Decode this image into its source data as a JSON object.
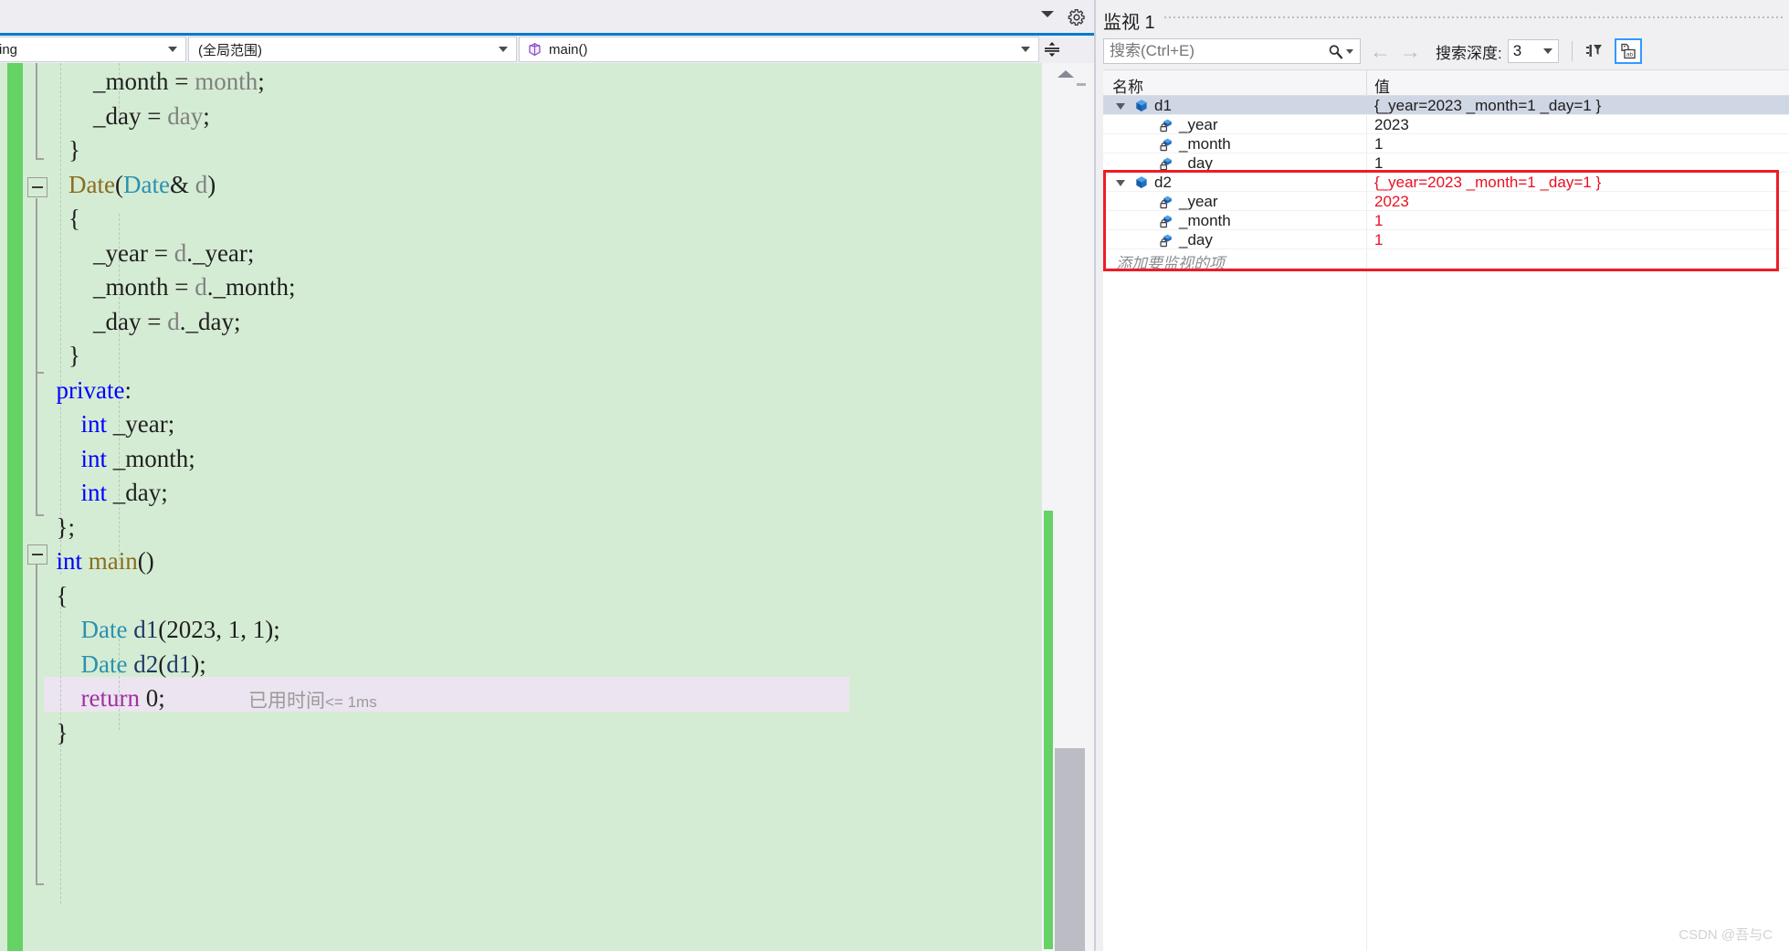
{
  "editor": {
    "navbar": {
      "project_dropdown": "ing",
      "scope_dropdown": "(全局范围)",
      "member_dropdown": "main()",
      "member_icon": "method-cube-icon",
      "caret_icon": "chevron-down-icon",
      "split_icon": "split-window-icon"
    },
    "doc_well": {
      "overflow_icon": "chevron-down-icon",
      "settings_icon": "gear-icon"
    },
    "code_lines": [
      {
        "indent": 0,
        "tokens": [
          {
            "t": "        _month ",
            "c": "plain"
          },
          {
            "t": "= ",
            "c": "punct"
          },
          {
            "t": "month",
            "c": "var"
          },
          {
            "t": ";",
            "c": "punct"
          }
        ]
      },
      {
        "indent": 0,
        "tokens": [
          {
            "t": "        _day ",
            "c": "plain"
          },
          {
            "t": "= ",
            "c": "punct"
          },
          {
            "t": "day",
            "c": "var"
          },
          {
            "t": ";",
            "c": "punct"
          }
        ]
      },
      {
        "indent": 0,
        "tokens": [
          {
            "t": "    }",
            "c": "plain"
          }
        ]
      },
      {
        "indent": 0,
        "tokens": [
          {
            "t": "    ",
            "c": "plain"
          },
          {
            "t": "Date",
            "c": "func"
          },
          {
            "t": "(",
            "c": "punct"
          },
          {
            "t": "Date",
            "c": "type"
          },
          {
            "t": "& ",
            "c": "plain"
          },
          {
            "t": "d",
            "c": "var"
          },
          {
            "t": ")",
            "c": "punct"
          }
        ]
      },
      {
        "indent": 0,
        "tokens": [
          {
            "t": "    {",
            "c": "plain"
          }
        ]
      },
      {
        "indent": 0,
        "tokens": [
          {
            "t": "        _year ",
            "c": "plain"
          },
          {
            "t": "= ",
            "c": "punct"
          },
          {
            "t": "d",
            "c": "var"
          },
          {
            "t": ".",
            "c": "punct"
          },
          {
            "t": "_year",
            "c": "plain"
          },
          {
            "t": ";",
            "c": "punct"
          }
        ]
      },
      {
        "indent": 0,
        "tokens": [
          {
            "t": "        _month ",
            "c": "plain"
          },
          {
            "t": "= ",
            "c": "punct"
          },
          {
            "t": "d",
            "c": "var"
          },
          {
            "t": ".",
            "c": "punct"
          },
          {
            "t": "_month",
            "c": "plain"
          },
          {
            "t": ";",
            "c": "punct"
          }
        ]
      },
      {
        "indent": 0,
        "tokens": [
          {
            "t": "        _day ",
            "c": "plain"
          },
          {
            "t": "= ",
            "c": "punct"
          },
          {
            "t": "d",
            "c": "var"
          },
          {
            "t": ".",
            "c": "punct"
          },
          {
            "t": "_day",
            "c": "plain"
          },
          {
            "t": ";",
            "c": "punct"
          }
        ]
      },
      {
        "indent": 0,
        "tokens": [
          {
            "t": "    }",
            "c": "plain"
          }
        ]
      },
      {
        "indent": 0,
        "tokens": [
          {
            "t": "  ",
            "c": "plain"
          },
          {
            "t": "private",
            "c": "kw"
          },
          {
            "t": ":",
            "c": "punct"
          }
        ]
      },
      {
        "indent": 0,
        "tokens": [
          {
            "t": "      ",
            "c": "plain"
          },
          {
            "t": "int",
            "c": "kw"
          },
          {
            "t": " _year;",
            "c": "plain"
          }
        ]
      },
      {
        "indent": 0,
        "tokens": [
          {
            "t": "      ",
            "c": "plain"
          },
          {
            "t": "int",
            "c": "kw"
          },
          {
            "t": " _month;",
            "c": "plain"
          }
        ]
      },
      {
        "indent": 0,
        "tokens": [
          {
            "t": "      ",
            "c": "plain"
          },
          {
            "t": "int",
            "c": "kw"
          },
          {
            "t": " _day;",
            "c": "plain"
          }
        ]
      },
      {
        "indent": 0,
        "tokens": [
          {
            "t": "  };",
            "c": "plain"
          }
        ]
      },
      {
        "indent": 0,
        "tokens": [
          {
            "t": "  ",
            "c": "plain"
          },
          {
            "t": "int",
            "c": "kw"
          },
          {
            "t": " ",
            "c": "plain"
          },
          {
            "t": "main",
            "c": "func"
          },
          {
            "t": "()",
            "c": "punct"
          }
        ]
      },
      {
        "indent": 0,
        "tokens": [
          {
            "t": "  {",
            "c": "plain"
          }
        ]
      },
      {
        "indent": 0,
        "tokens": [
          {
            "t": "      ",
            "c": "plain"
          },
          {
            "t": "Date",
            "c": "type"
          },
          {
            "t": " ",
            "c": "plain"
          },
          {
            "t": "d1",
            "c": "local"
          },
          {
            "t": "(2023, 1, 1);",
            "c": "punct"
          }
        ]
      },
      {
        "indent": 0,
        "tokens": [
          {
            "t": "      ",
            "c": "plain"
          },
          {
            "t": "Date",
            "c": "type"
          },
          {
            "t": " ",
            "c": "plain"
          },
          {
            "t": "d2",
            "c": "local"
          },
          {
            "t": "(",
            "c": "punct"
          },
          {
            "t": "d1",
            "c": "local"
          },
          {
            "t": ");",
            "c": "punct"
          }
        ]
      },
      {
        "indent": 0,
        "tokens": [
          {
            "t": "      ",
            "c": "plain"
          },
          {
            "t": "return",
            "c": "ctrl"
          },
          {
            "t": " ",
            "c": "plain"
          },
          {
            "t": "0",
            "c": "num"
          },
          {
            "t": ";",
            "c": "punct"
          }
        ]
      },
      {
        "indent": 0,
        "tokens": [
          {
            "t": "  }",
            "c": "plain"
          }
        ]
      }
    ],
    "elapsed_hint_cn": "已用时间",
    "elapsed_hint_ms": "<= 1ms",
    "scrollbar": {
      "up_arrow_icon": "scroll-up-arrow-icon",
      "thumb_name": "vertical-scroll-thumb"
    },
    "colors": {
      "editor_background": "#d5ecd4",
      "change_bar": "#64d264",
      "current_line": "#ece4f0",
      "keyword": "#0000ff",
      "type": "#2b91af",
      "function": "#8a6d1f",
      "control": "#a031a0",
      "local": "#1f3864"
    }
  },
  "watch": {
    "title": "监视 1",
    "toolbar": {
      "search_placeholder": "搜索(Ctrl+E)",
      "search_value": "",
      "search_icon": "magnifier-icon",
      "search_dropdown_icon": "chevron-down-icon",
      "back_arrow": "←",
      "forward_arrow": "→",
      "depth_label": "搜索深度:",
      "depth_value": "3",
      "depth_caret_icon": "chevron-down-icon",
      "pin_filter_icon": "pin-filter-icon",
      "tag_icon": "hex-tag-icon"
    },
    "columns": {
      "name": "名称",
      "value": "值"
    },
    "rows": [
      {
        "depth": 0,
        "expanded": true,
        "icon": "object-cube-icon",
        "name": "d1",
        "value": "{_year=2023 _month=1 _day=1 }",
        "selected": true,
        "changed": false
      },
      {
        "depth": 1,
        "expanded": false,
        "icon": "field-lock-icon",
        "name": "_year",
        "value": "2023",
        "selected": false,
        "changed": false
      },
      {
        "depth": 1,
        "expanded": false,
        "icon": "field-lock-icon",
        "name": "_month",
        "value": "1",
        "selected": false,
        "changed": false
      },
      {
        "depth": 1,
        "expanded": false,
        "icon": "field-lock-icon",
        "name": "_day",
        "value": "1",
        "selected": false,
        "changed": false
      },
      {
        "depth": 0,
        "expanded": true,
        "icon": "object-cube-icon",
        "name": "d2",
        "value": "{_year=2023 _month=1 _day=1 }",
        "selected": false,
        "changed": true
      },
      {
        "depth": 1,
        "expanded": false,
        "icon": "field-lock-icon",
        "name": "_year",
        "value": "2023",
        "selected": false,
        "changed": true
      },
      {
        "depth": 1,
        "expanded": false,
        "icon": "field-lock-icon",
        "name": "_month",
        "value": "1",
        "selected": false,
        "changed": true
      },
      {
        "depth": 1,
        "expanded": false,
        "icon": "field-lock-icon",
        "name": "_day",
        "value": "1",
        "selected": false,
        "changed": true
      }
    ],
    "add_item_placeholder": "添加要监视的项",
    "annotation_color": "#ee1c25",
    "changed_value_color": "#e81123"
  },
  "watermark": "CSDN @吾与C"
}
